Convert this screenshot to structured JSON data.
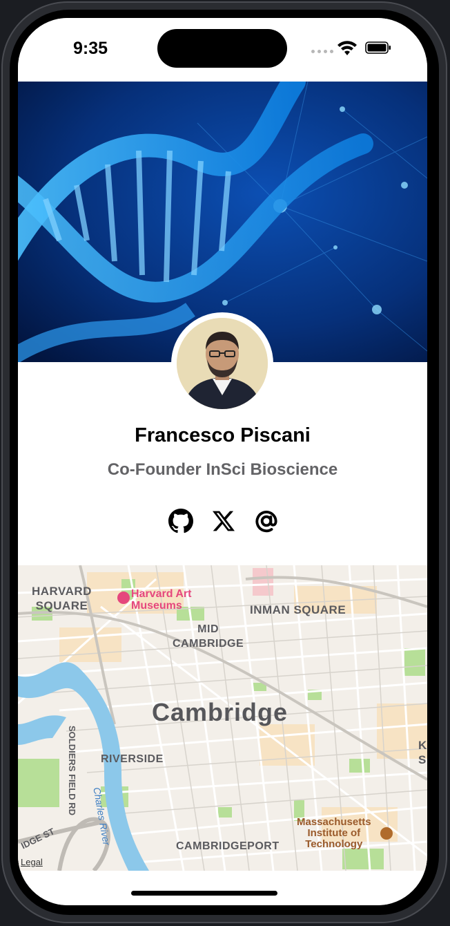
{
  "status_bar": {
    "time": "9:35"
  },
  "profile": {
    "name": "Francesco Piscani",
    "title": "Co-Founder InSci Bioscience"
  },
  "socials": [
    {
      "icon": "github-icon"
    },
    {
      "icon": "x-icon"
    },
    {
      "icon": "at-sign-icon"
    }
  ],
  "map": {
    "labels": {
      "harvard_square": "HARVARD\nSQUARE",
      "harvard_art_museums": "Harvard Art\nMuseums",
      "inman_square": "INMAN SQUARE",
      "mid_cambridge": "MID\nCAMBRIDGE",
      "cambridge": "Cambridge",
      "riverside": "RIVERSIDE",
      "soldiers_field_rd": "SOLDIERS FIELD RD",
      "charles_river": "Charles River",
      "cambridgeport": "CAMBRIDGEPORT",
      "mit": "Massachusetts\nInstitute of\nTechnology",
      "bridge_st": "IDGE ST",
      "legal": "Legal",
      "edge": "K\nS"
    },
    "colors": {
      "water": "#8cc8ea",
      "park": "#a8d88b",
      "land": "#f3efe9",
      "road": "#ffffff"
    }
  },
  "colors": {
    "subtitle": "#636366",
    "hero_blue": "#1a8be0"
  }
}
